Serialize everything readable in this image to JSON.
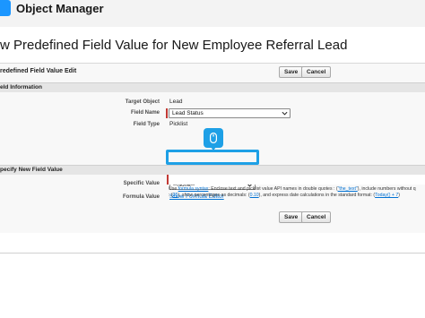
{
  "app": {
    "title": "Object Manager"
  },
  "page": {
    "title": "w Predefined Field Value for New Employee Referral Lead"
  },
  "edit_block": {
    "title": "redefined Field Value Edit",
    "save_label": "Save",
    "cancel_label": "Cancel"
  },
  "field_info": {
    "header": "eld Information",
    "target_object_label": "Target Object",
    "target_object_value": "Lead",
    "field_name_label": "Field Name",
    "field_name_value": "Lead Status",
    "field_type_label": "Field Type",
    "field_type_value": "Picklist"
  },
  "new_value": {
    "header": "pecify New Field Value",
    "specific_value_label": "Specific Value",
    "specific_value_selected": "--None--",
    "formula_value_label": "Formula Value",
    "formula_editor_link": "Show Formula Editor",
    "hint_prefix": "Use ",
    "hint_link": "formula syntax",
    "hint_line1": ": Enclose text and picklist value API names in double quotes : (",
    "hint_text_example": "\"the_text\"",
    "hint_line1_end": "), include numbers without q",
    "hint_line2_start": ": (",
    "hint_number": "25",
    "hint_line2_mid": "), show percentages as decimals: (",
    "hint_decimal": "0.10",
    "hint_line2_end": "), and express date calculations in the standard format: (",
    "hint_date": "Today() + 7",
    "hint_line2_close": ")"
  },
  "bottom": {
    "save_label": "Save",
    "cancel_label": "Cancel"
  }
}
